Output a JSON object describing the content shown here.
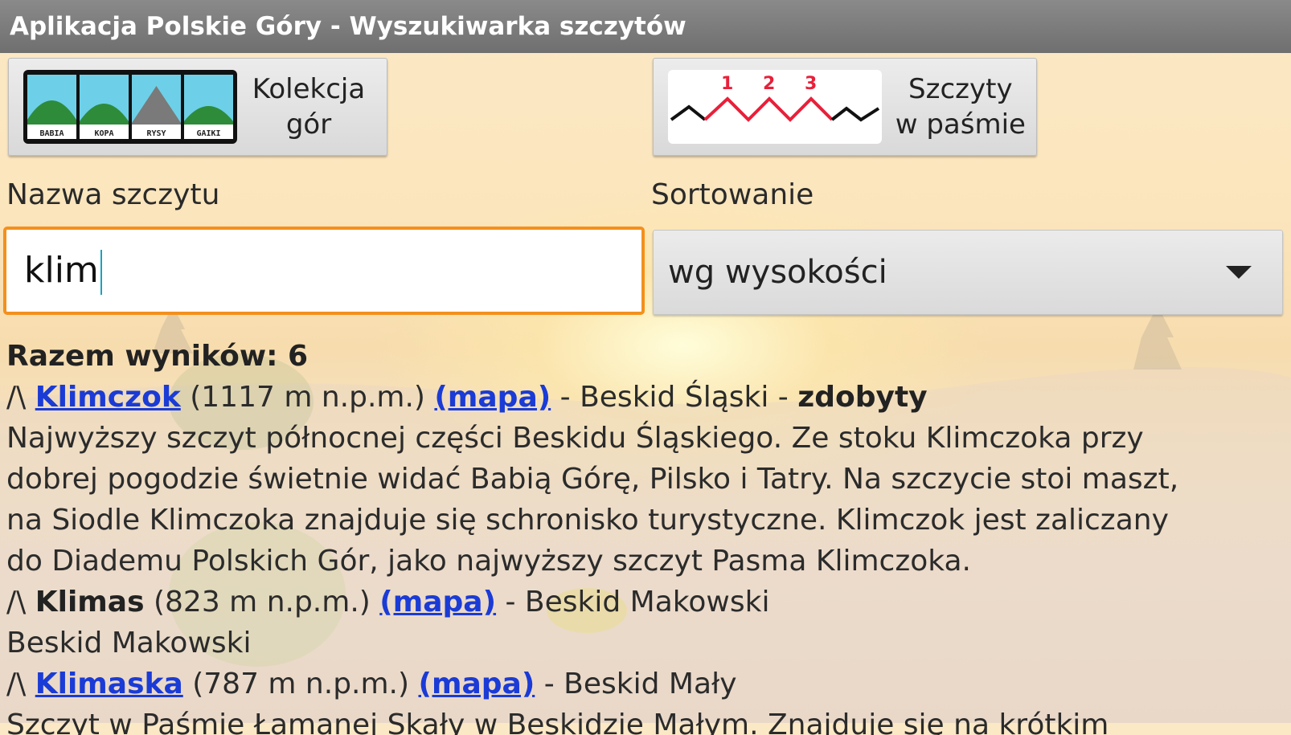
{
  "window": {
    "title": "Aplikacja Polskie Góry - Wyszukiwarka szczytów"
  },
  "buttons": {
    "collection": {
      "label": "Kolekcja\ngór",
      "thumbs": [
        "BABIA",
        "KOPA",
        "RYSY",
        "GAIKI"
      ]
    },
    "range": {
      "label": "Szczyty\nw paśmie",
      "numbers": [
        "1",
        "2",
        "3"
      ]
    }
  },
  "search": {
    "label": "Nazwa szczytu",
    "value": "klim"
  },
  "sort": {
    "label": "Sortowanie",
    "selected": "wg wysokości"
  },
  "results": {
    "total": "Razem wyników: 6",
    "marker": "/\\",
    "items": [
      {
        "name": "Klimczok",
        "height": "(1117 m n.p.m.)",
        "map_label": "(mapa)",
        "range": "- Beskid Śląski -",
        "status": "zdobyty",
        "description_lines": [
          "Najwyższy szczyt północnej części Beskidu Śląskiego. Ze stoku Klimczoka przy",
          "dobrej pogodzie świetnie widać Babią Górę, Pilsko i Tatry. Na szczycie stoi maszt,",
          "na Siodle Klimczoka znajduje się schronisko turystyczne. Klimczok jest zaliczany",
          "do Diademu Polskich Gór, jako najwyższy szczyt Pasma Klimczoka."
        ]
      },
      {
        "name": "Klimas",
        "height": "(823 m n.p.m.)",
        "map_label": "(mapa)",
        "range": "- Beskid Makowski",
        "description_lines": [
          "Beskid Makowski"
        ]
      },
      {
        "name": "Klimaska",
        "height": "(787 m n.p.m.)",
        "map_label": "(mapa)",
        "range": "- Beskid Mały",
        "description_lines": [
          "Szczyt w Paśmie Łamanej Skały w Beskidzie Małym. Znajduje się na krótkim"
        ]
      }
    ]
  }
}
